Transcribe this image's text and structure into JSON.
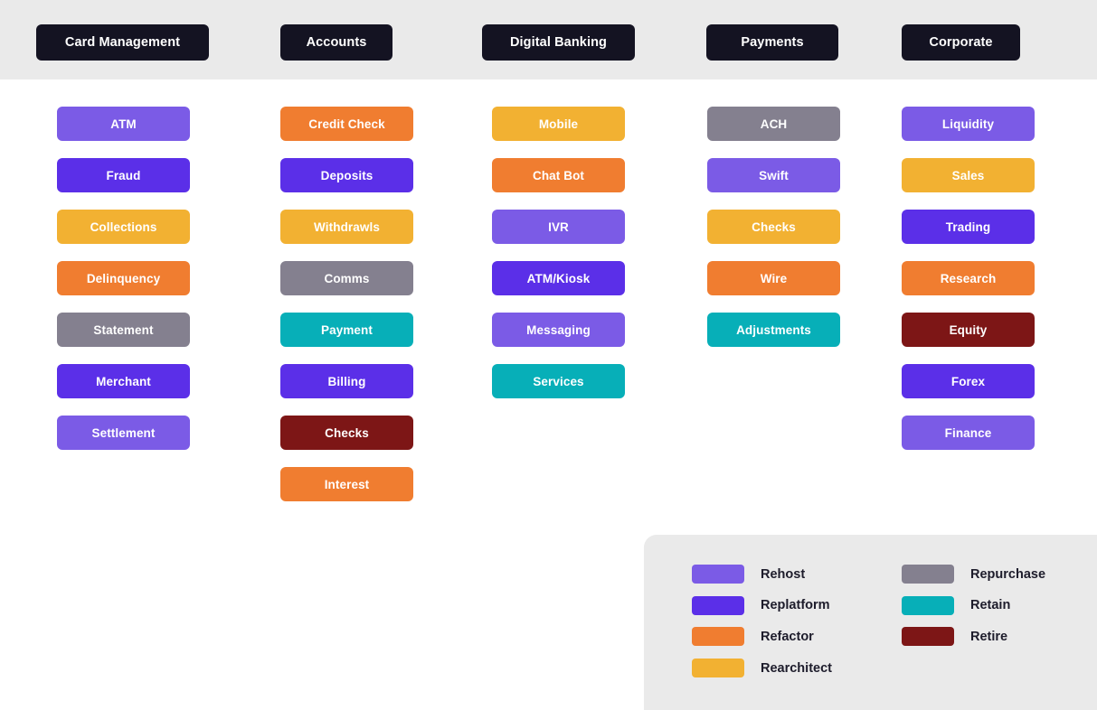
{
  "palette": {
    "page_background": "#ffffff",
    "header_band_background": "#eaeaea",
    "header_pill_background": "#141322",
    "header_pill_text": "#ffffff",
    "legend_panel_background": "#eaeaea",
    "legend_label_text": "#1d1c2b",
    "rehost": "#7b5be6",
    "replatform": "#5b2fe8",
    "refactor": "#f07d30",
    "rearchitect": "#f2b132",
    "repurchase": "#84808f",
    "retain": "#07afb8",
    "retire": "#7d1616"
  },
  "columns": [
    {
      "header": "Card Management",
      "tiles": [
        {
          "label": "ATM",
          "category": "Rehost",
          "color": "#7b5be6"
        },
        {
          "label": "Fraud",
          "category": "Replatform",
          "color": "#5b2fe8"
        },
        {
          "label": "Collections",
          "category": "Rearchitect",
          "color": "#f2b132"
        },
        {
          "label": "Delinquency",
          "category": "Refactor",
          "color": "#f07d30"
        },
        {
          "label": "Statement",
          "category": "Repurchase",
          "color": "#84808f"
        },
        {
          "label": "Merchant",
          "category": "Replatform",
          "color": "#5b2fe8"
        },
        {
          "label": "Settlement",
          "category": "Rehost",
          "color": "#7b5be6"
        }
      ]
    },
    {
      "header": "Accounts",
      "tiles": [
        {
          "label": "Credit Check",
          "category": "Refactor",
          "color": "#f07d30"
        },
        {
          "label": "Deposits",
          "category": "Replatform",
          "color": "#5b2fe8"
        },
        {
          "label": "Withdrawls",
          "category": "Rearchitect",
          "color": "#f2b132"
        },
        {
          "label": "Comms",
          "category": "Repurchase",
          "color": "#84808f"
        },
        {
          "label": "Payment",
          "category": "Retain",
          "color": "#07afb8"
        },
        {
          "label": "Billing",
          "category": "Replatform",
          "color": "#5b2fe8"
        },
        {
          "label": "Checks",
          "category": "Retire",
          "color": "#7d1616"
        },
        {
          "label": "Interest",
          "category": "Refactor",
          "color": "#f07d30"
        }
      ]
    },
    {
      "header": "Digital Banking",
      "tiles": [
        {
          "label": "Mobile",
          "category": "Rearchitect",
          "color": "#f2b132"
        },
        {
          "label": "Chat Bot",
          "category": "Refactor",
          "color": "#f07d30"
        },
        {
          "label": "IVR",
          "category": "Rehost",
          "color": "#7b5be6"
        },
        {
          "label": "ATM/Kiosk",
          "category": "Replatform",
          "color": "#5b2fe8"
        },
        {
          "label": "Messaging",
          "category": "Rehost",
          "color": "#7b5be6"
        },
        {
          "label": "Services",
          "category": "Retain",
          "color": "#07afb8"
        }
      ]
    },
    {
      "header": "Payments",
      "tiles": [
        {
          "label": "ACH",
          "category": "Repurchase",
          "color": "#84808f"
        },
        {
          "label": "Swift",
          "category": "Rehost",
          "color": "#7b5be6"
        },
        {
          "label": "Checks",
          "category": "Rearchitect",
          "color": "#f2b132"
        },
        {
          "label": "Wire",
          "category": "Refactor",
          "color": "#f07d30"
        },
        {
          "label": "Adjustments",
          "category": "Retain",
          "color": "#07afb8"
        }
      ]
    },
    {
      "header": "Corporate",
      "tiles": [
        {
          "label": "Liquidity",
          "category": "Rehost",
          "color": "#7b5be6"
        },
        {
          "label": "Sales",
          "category": "Rearchitect",
          "color": "#f2b132"
        },
        {
          "label": "Trading",
          "category": "Replatform",
          "color": "#5b2fe8"
        },
        {
          "label": "Research",
          "category": "Refactor",
          "color": "#f07d30"
        },
        {
          "label": "Equity",
          "category": "Retire",
          "color": "#7d1616"
        },
        {
          "label": "Forex",
          "category": "Replatform",
          "color": "#5b2fe8"
        },
        {
          "label": "Finance",
          "category": "Rehost",
          "color": "#7b5be6"
        }
      ]
    }
  ],
  "legend": {
    "items": [
      {
        "label": "Rehost",
        "color": "#7b5be6"
      },
      {
        "label": "Replatform",
        "color": "#5b2fe8"
      },
      {
        "label": "Refactor",
        "color": "#f07d30"
      },
      {
        "label": "Rearchitect",
        "color": "#f2b132"
      },
      {
        "label": "Repurchase",
        "color": "#84808f"
      },
      {
        "label": "Retain",
        "color": "#07afb8"
      },
      {
        "label": "Retire",
        "color": "#7d1616"
      }
    ]
  }
}
